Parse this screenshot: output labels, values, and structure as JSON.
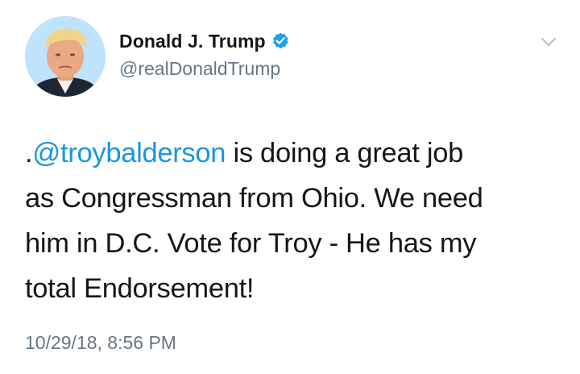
{
  "user": {
    "display_name": "Donald J. Trump",
    "handle": "@realDonaldTrump",
    "verified": true,
    "verified_icon": "verified-badge-icon"
  },
  "tweet": {
    "lead": ".",
    "mention": "@troybalderson",
    "line1_rest": " is doing a great job",
    "line2": "as Congressman from Ohio. We need",
    "line3": "him in D.C. Vote for Troy - He has my",
    "line4": "total Endorsement!"
  },
  "timestamp": "10/29/18, 8:56 PM",
  "menu": {
    "icon": "chevron-down-icon"
  },
  "colors": {
    "link": "#1b95e0",
    "verified": "#1da1f2",
    "secondary_text": "#657786",
    "primary_text": "#14171a"
  }
}
